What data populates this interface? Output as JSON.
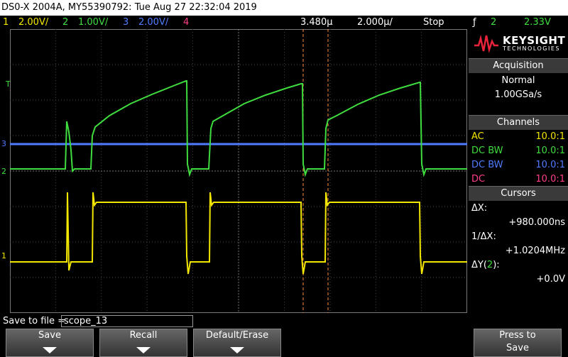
{
  "title_bar": "DS0-X 2004A, MY55390792: Tue Aug 27 22:32:04 2019",
  "channels_bar": {
    "ch1_num": "1",
    "ch1_scale": "2.00V/",
    "ch2_num": "2",
    "ch2_scale": "1.00V/",
    "ch3_num": "3",
    "ch3_scale": "2.00V/",
    "ch4_num": "4",
    "time_delay": "3.480µ",
    "time_scale": "2.000µ/",
    "run_state": "Stop",
    "trigger_icon": "ƒ",
    "trigger_source": "2",
    "trigger_level": "2.33V"
  },
  "markers": {
    "ch1": "1",
    "ch2": "2",
    "ch3": "3",
    "trig": "T"
  },
  "logo": {
    "brand": "KEYSIGHT",
    "sub": "TECHNOLOGIES"
  },
  "acquisition": {
    "header": "Acquisition",
    "mode": "Normal",
    "rate": "1.00GSa/s"
  },
  "channels_panel": {
    "header": "Channels",
    "rows": [
      {
        "coupling": "AC",
        "probe": "10.0:1"
      },
      {
        "coupling": "DC BW",
        "probe": "10.0:1"
      },
      {
        "coupling": "DC BW",
        "probe": "10.0:1"
      },
      {
        "coupling": "DC",
        "probe": "10.0:1"
      }
    ]
  },
  "cursors": {
    "header": "Cursors",
    "dx_label": "ΔX:",
    "dx_value": "+980.000ns",
    "inv_label": "1/ΔX:",
    "inv_value": "+1.0204MHz",
    "dy_label_a": "ΔY(",
    "dy_ch": "2",
    "dy_label_b": "):",
    "dy_value": "+0.0V"
  },
  "save": {
    "label": "Save to file =",
    "filename": "scope_13"
  },
  "softkeys": {
    "save": "Save",
    "recall": "Recall",
    "default": "Default/Erase",
    "press_to": "Press to",
    "press_save": "Save"
  },
  "colors": {
    "ch1": "#f3e600",
    "ch2": "#3fdc3f",
    "ch3": "#4f7bff",
    "ch4": "#ff3f8a",
    "cursor": "#ff8c3a"
  }
}
